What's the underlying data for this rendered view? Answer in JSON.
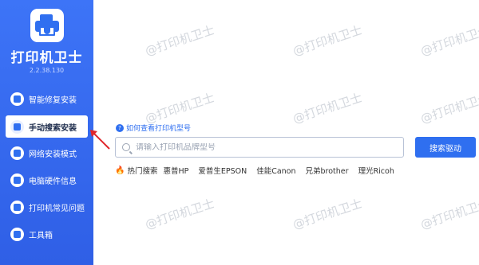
{
  "app": {
    "title": "打印机卫士",
    "version": "2.2.38.130"
  },
  "sidebar": {
    "items": [
      {
        "label": "智能修复安装",
        "icon": "wrench-gear-icon"
      },
      {
        "label": "手动搜索安装",
        "icon": "wrench-icon"
      },
      {
        "label": "网络安装模式",
        "icon": "network-icon"
      },
      {
        "label": "电脑硬件信息",
        "icon": "computer-icon"
      },
      {
        "label": "打印机常见问题",
        "icon": "question-icon"
      },
      {
        "label": "工具箱",
        "icon": "toolbox-icon"
      }
    ],
    "active_index": 1
  },
  "main": {
    "help_link": "如何查看打印机型号",
    "search": {
      "placeholder": "请输入打印机品牌型号",
      "button": "搜索驱动"
    },
    "hot": {
      "label": "热门搜索",
      "brands": [
        "惠普HP",
        "爱普生EPSON",
        "佳能Canon",
        "兄弟brother",
        "理光Ricoh"
      ]
    },
    "watermark": "@打印机卫士"
  },
  "colors": {
    "sidebar": "#3d74f7",
    "accent": "#2f6ff0",
    "arrow": "#e0262b"
  }
}
